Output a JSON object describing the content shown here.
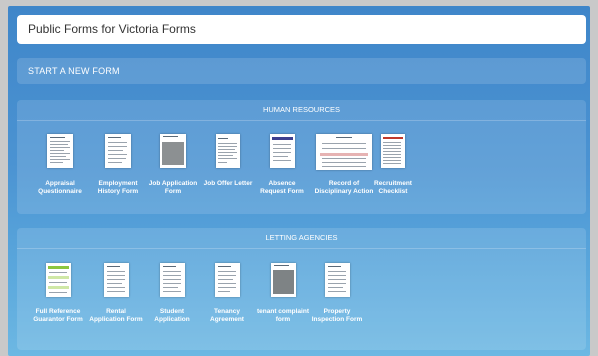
{
  "page": {
    "title": "Public Forms for Victoria Forms",
    "start_label": "START A NEW FORM"
  },
  "sections": [
    {
      "header": "HUMAN RESOURCES",
      "forms": [
        {
          "label": "Appraisal Questionnaire",
          "icon": "text-document-thumbnail"
        },
        {
          "label": "Employment History Form",
          "icon": "text-document-thumbnail"
        },
        {
          "label": "Job Application Form",
          "icon": "photo-document-thumbnail"
        },
        {
          "label": "Job Offer Letter",
          "icon": "letter-document-thumbnail"
        },
        {
          "label": "Absence Request Form",
          "icon": "form-document-thumbnail"
        },
        {
          "label": "Record of Disciplinary Action",
          "icon": "table-document-thumbnail"
        },
        {
          "label": "Recruitment Checklist",
          "icon": "checklist-document-thumbnail"
        }
      ]
    },
    {
      "header": "LETTING AGENCIES",
      "forms": [
        {
          "label": "Full Reference Guarantor Form",
          "icon": "green-form-thumbnail"
        },
        {
          "label": "Rental Application Form",
          "icon": "form-document-thumbnail"
        },
        {
          "label": "Student Application",
          "icon": "form-document-thumbnail"
        },
        {
          "label": "Tenancy Agreement",
          "icon": "form-document-thumbnail"
        },
        {
          "label": "tenant complaint form",
          "icon": "photo-document-thumbnail"
        },
        {
          "label": "Property Inspection Form",
          "icon": "form-document-thumbnail"
        }
      ]
    }
  ],
  "colors": {
    "background": "#4b93d2",
    "panel": "rgba(255,255,255,0.13)",
    "text": "#ffffff"
  }
}
